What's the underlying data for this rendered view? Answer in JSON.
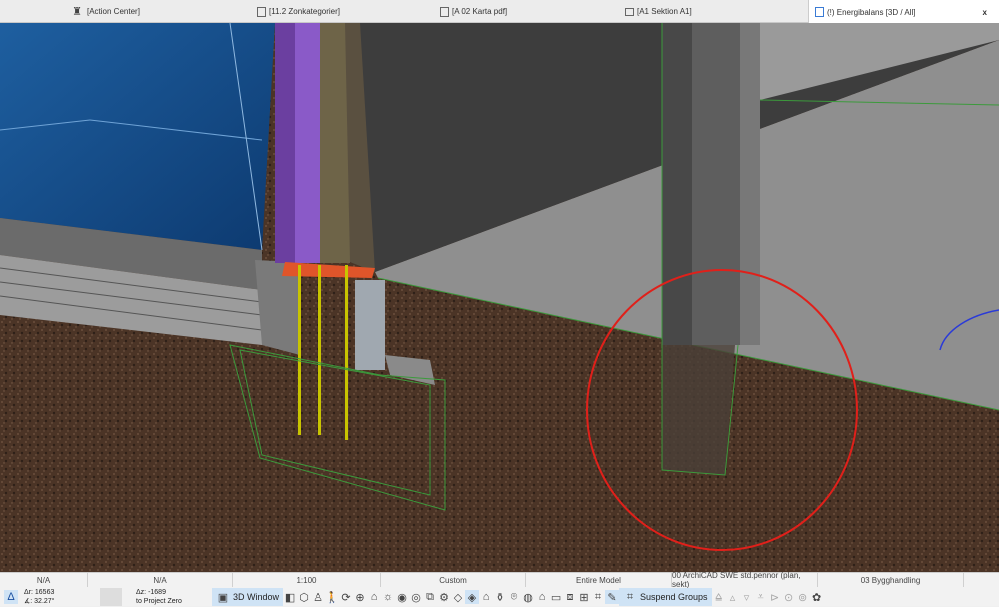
{
  "tabs": [
    {
      "label": "[Action Center]",
      "icon": "action-center-icon"
    },
    {
      "label": "[11.2 Zonkategorier]",
      "icon": "schedule-icon"
    },
    {
      "label": "[A 02 Karta pdf]",
      "icon": "layout-icon"
    },
    {
      "label": "[A1 Sektion A1]",
      "icon": "section-icon"
    },
    {
      "label": "(!) Energibalans [3D / All]",
      "icon": "3d-window-icon",
      "active": true,
      "close": "x"
    }
  ],
  "status": {
    "row1": {
      "layer_combo": "N/A",
      "pen_set": "N/A",
      "scale": "1:100",
      "custom": "Custom",
      "model_view": "Entire Model",
      "pen_set_name": "00 ArchiCAD SWE std.pennor (plan, sekt)",
      "renovation": "03 Bygghandling"
    },
    "coords": {
      "a": "Δr: 16563",
      "b": "∡: 32.27°",
      "dz": "Δz: -1689",
      "ref": "to Project Zero"
    },
    "window_button": "3D Window",
    "suspend_groups": "Suspend Groups"
  },
  "annotation_color": "#e0201a"
}
